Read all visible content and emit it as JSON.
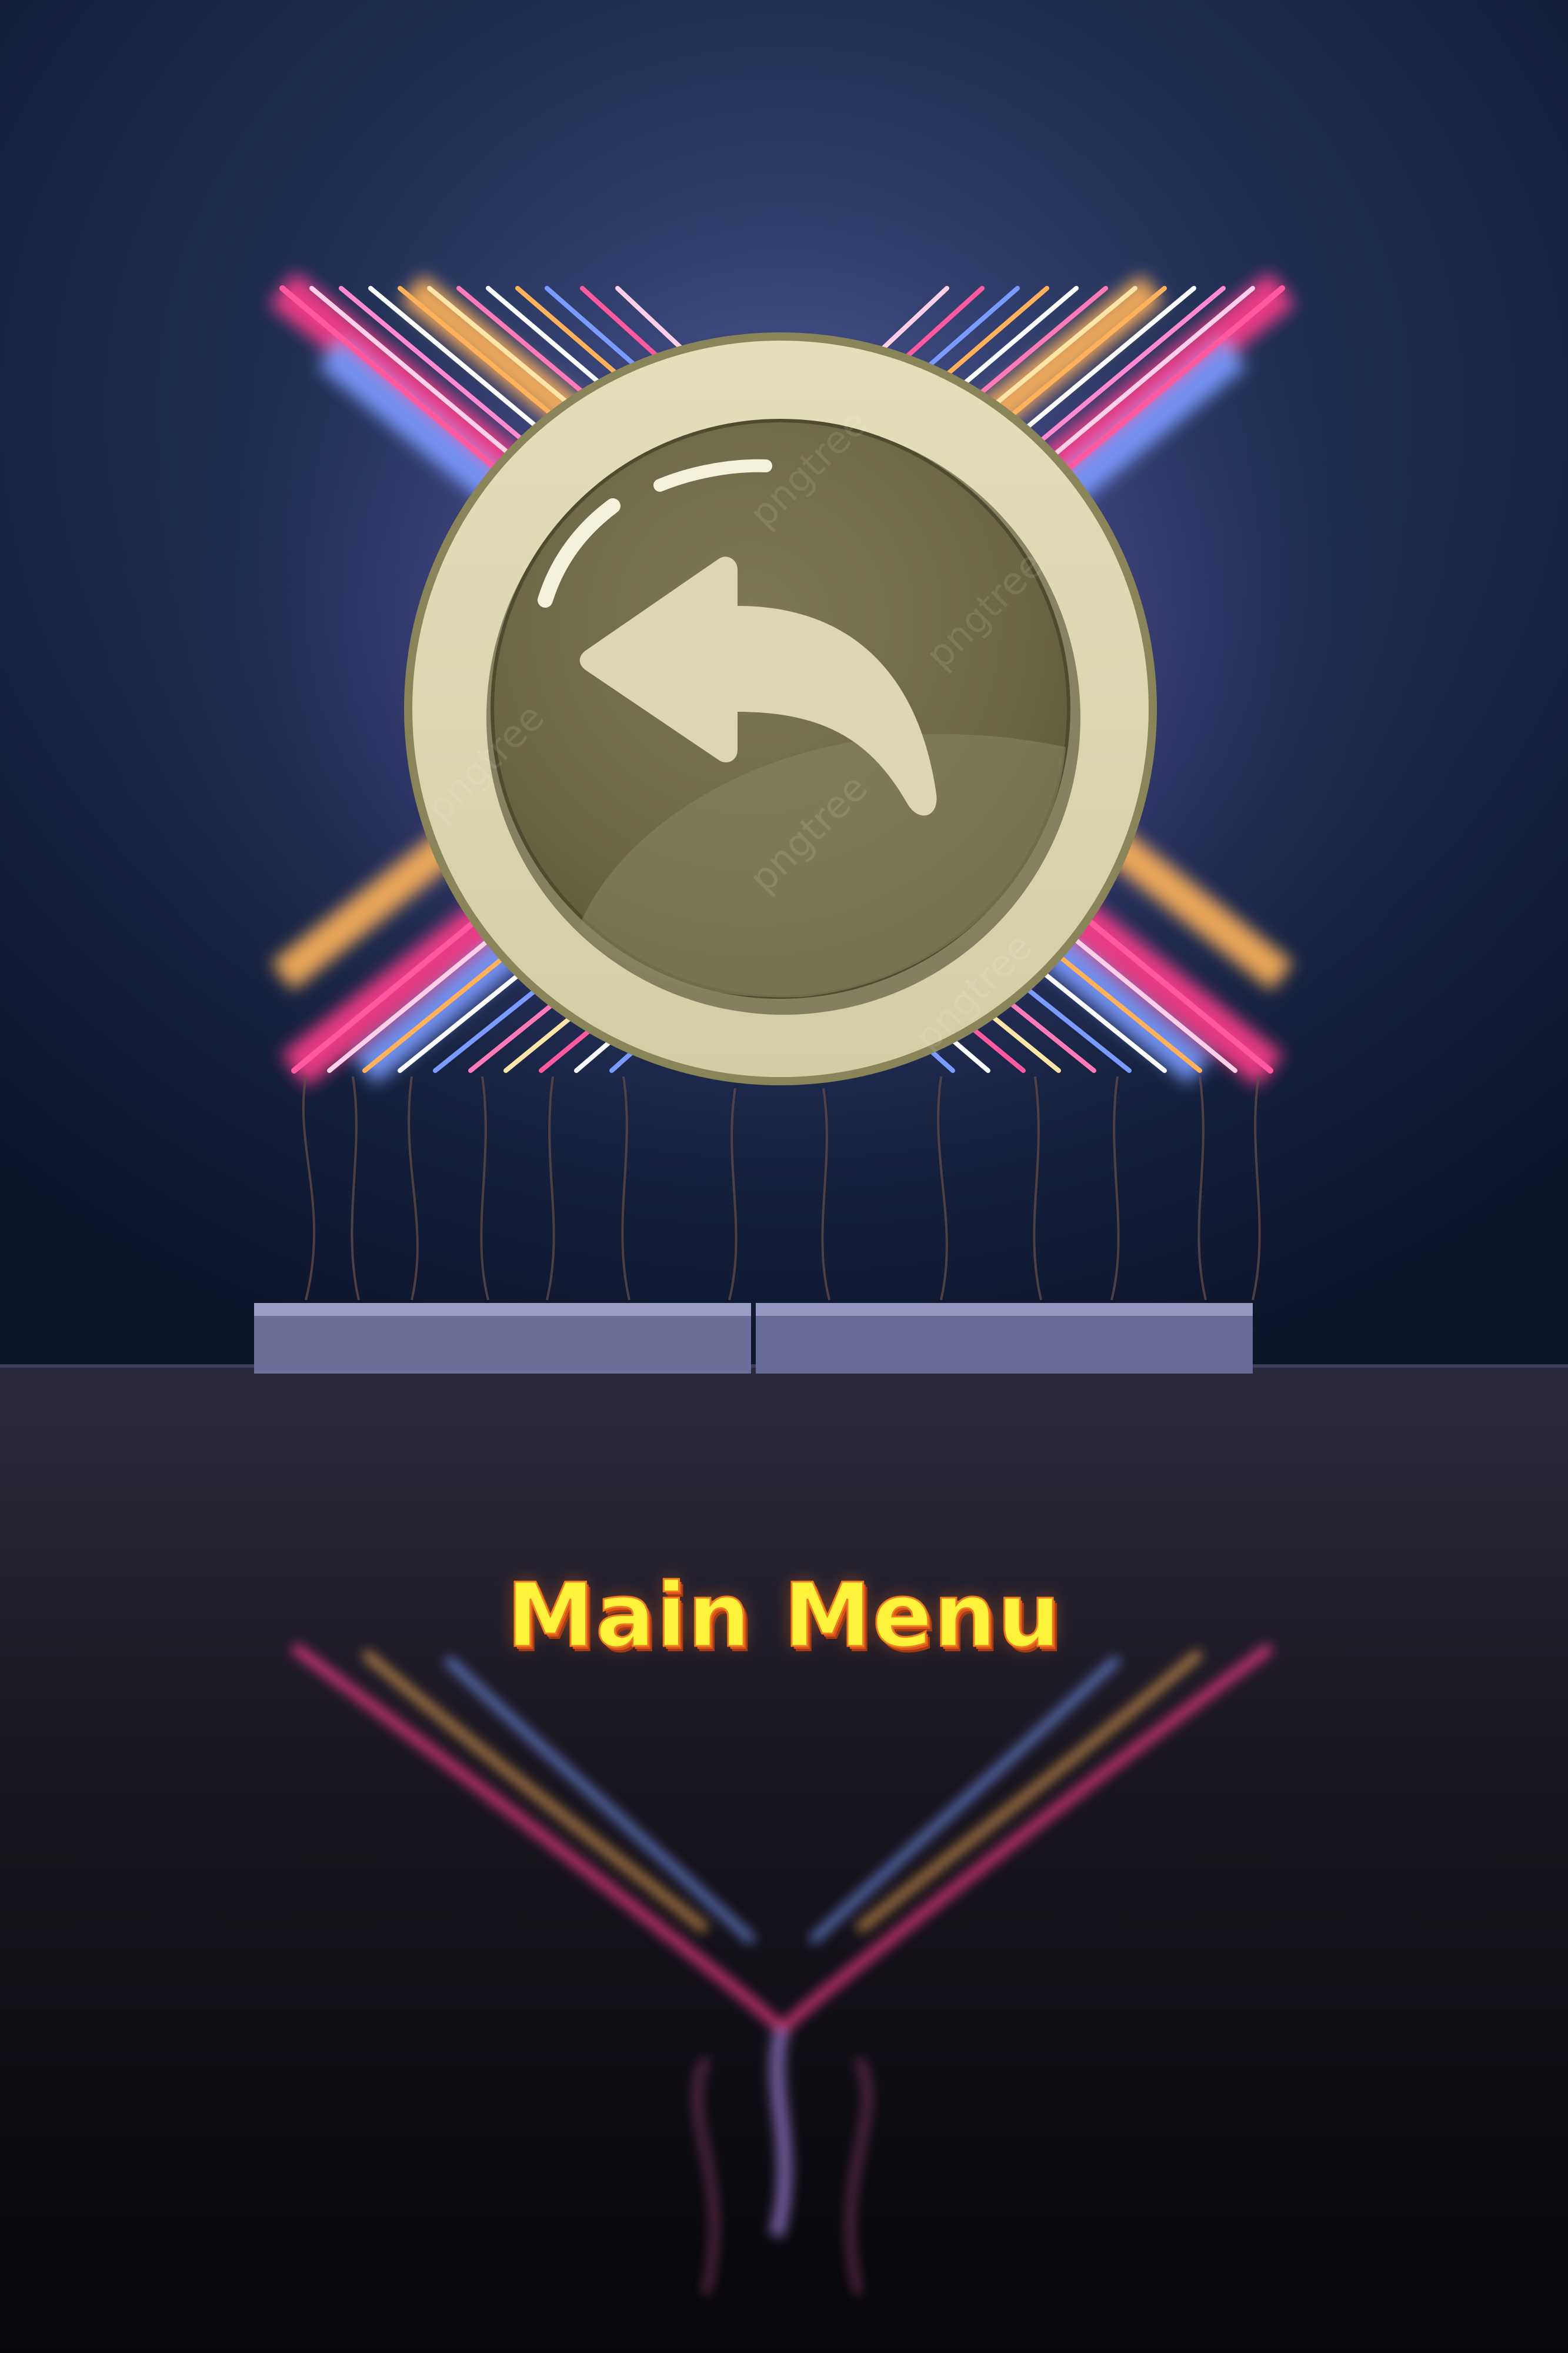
{
  "screen": {
    "type": "game-menu",
    "background": "neon-x-gallery"
  },
  "back_button": {
    "icon": "undo-arrow-icon",
    "rim_color": "#dcd7b0",
    "face_color": "#6f6a48",
    "arrow_color": "#dcd7b0"
  },
  "menu_title": {
    "text": "Main Menu",
    "color": "#fff23a",
    "shadow_color": "#d9541c"
  },
  "watermark": {
    "text": "pngtree"
  },
  "colors": {
    "wall": "#1b2a4a",
    "floor": "#120e14",
    "neon_pink": "#ff3d8a",
    "neon_blue": "#4aa0ff",
    "neon_orange": "#ffb25a"
  }
}
